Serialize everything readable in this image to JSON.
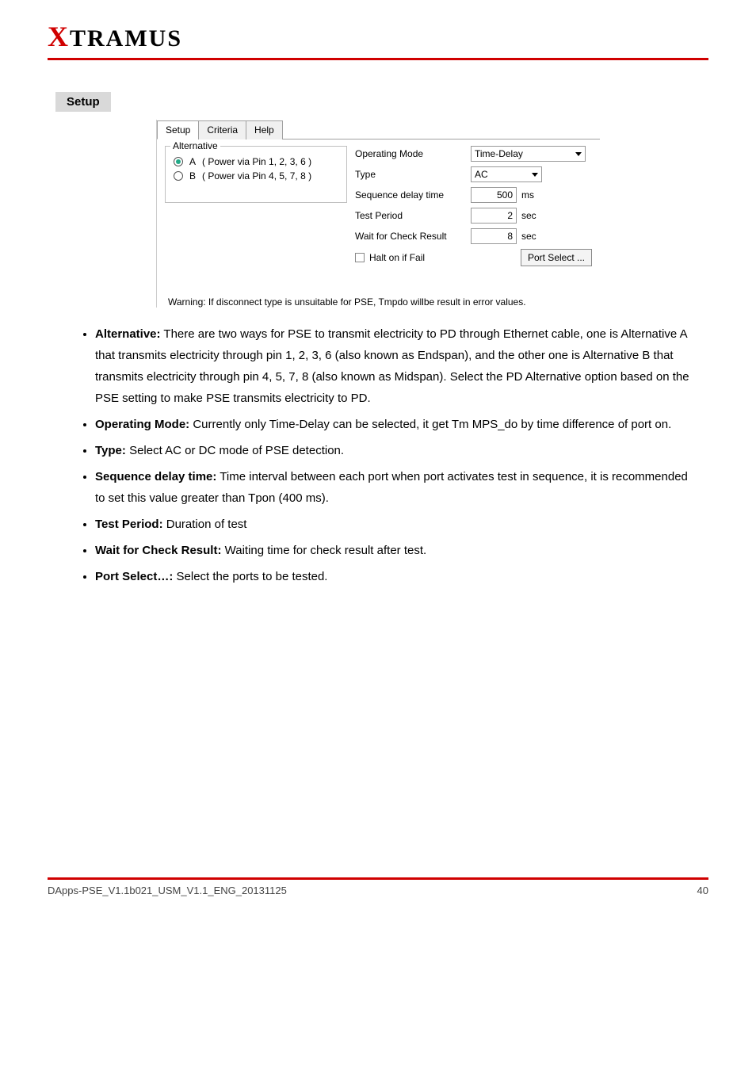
{
  "logo": {
    "x": "X",
    "rest": "TRAMUS"
  },
  "section": {
    "badge": "Setup"
  },
  "shot": {
    "tabs": [
      "Setup",
      "Criteria",
      "Help"
    ],
    "active_tab": 0,
    "alternative": {
      "legend": "Alternative",
      "options": [
        {
          "key": "A",
          "desc": "( Power via Pin 1, 2, 3, 6 )",
          "selected": true
        },
        {
          "key": "B",
          "desc": "( Power via Pin 4, 5, 7, 8 )",
          "selected": false
        }
      ]
    },
    "fields": {
      "operating_mode": {
        "label": "Operating Mode",
        "value": "Time-Delay"
      },
      "type": {
        "label": "Type",
        "value": "AC"
      },
      "seq_delay": {
        "label": "Sequence delay time",
        "value": "500",
        "unit": "ms"
      },
      "test_period": {
        "label": "Test Period",
        "value": "2",
        "unit": "sec"
      },
      "wait_check": {
        "label": "Wait for Check Result",
        "value": "8",
        "unit": "sec"
      },
      "halt": {
        "label": "Halt on if Fail",
        "checked": false
      },
      "port_select_btn": "Port Select ..."
    },
    "warning": "Warning: If disconnect type is unsuitable for PSE, Tmpdo willbe result in error values."
  },
  "bullets": [
    {
      "strong": "Alternative:",
      "text": " There are two ways for PSE to transmit electricity to PD through Ethernet cable, one is Alternative A that transmits electricity through pin 1, 2, 3, 6 (also known as Endspan), and the other one is Alternative B that transmits electricity through pin 4, 5, 7, 8 (also known as Midspan). Select the PD Alternative option based on the PSE setting to make PSE transmits electricity to PD."
    },
    {
      "strong": "Operating Mode:",
      "text": " Currently only Time-Delay can be selected, it get Tm MPS_do by time difference of port on."
    },
    {
      "strong": "Type:",
      "text": " Select AC or DC mode of PSE detection."
    },
    {
      "strong": "Sequence delay time:",
      "text": " Time interval between each port when port activates test in sequence, it is recommended to set this value greater than Tpon (400 ms)."
    },
    {
      "strong": "Test Period:",
      "text": " Duration of test"
    },
    {
      "strong": "Wait for Check Result:",
      "text": " Waiting time for check result after test."
    },
    {
      "strong": "Port Select…:",
      "text": " Select the ports to be tested."
    }
  ],
  "footer": {
    "left": "DApps-PSE_V1.1b021_USM_V1.1_ENG_20131125",
    "right": "40"
  }
}
